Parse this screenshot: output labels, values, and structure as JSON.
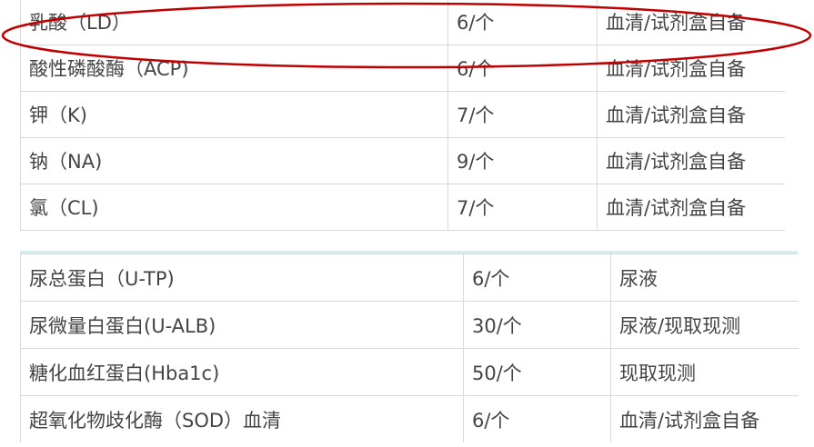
{
  "table_top": {
    "rows": [
      {
        "item": "乳酸（LD）",
        "price": "6/个",
        "sample": "血清/试剂盒自备"
      },
      {
        "item": "酸性磷酸酶（ACP)",
        "price": "6/个",
        "sample": "血清/试剂盒自备"
      },
      {
        "item": "钾（K)",
        "price": "7/个",
        "sample": "血清/试剂盒自备"
      },
      {
        "item": "钠（NA)",
        "price": "9/个",
        "sample": "血清/试剂盒自备"
      },
      {
        "item": "氯（CL)",
        "price": "7/个",
        "sample": "血清/试剂盒自备"
      }
    ]
  },
  "table_bottom": {
    "rows": [
      {
        "item": "尿总蛋白（U-TP)",
        "price": "6/个",
        "sample": "尿液"
      },
      {
        "item": "尿微量白蛋白(U-ALB)",
        "price": "30/个",
        "sample": "尿液/现取现测"
      },
      {
        "item": "糖化血红蛋白(Hba1c)",
        "price": "50/个",
        "sample": "现取现测"
      },
      {
        "item": "超氧化物歧化酶（SOD）血清",
        "price": "6/个",
        "sample": "血清/试剂盒自备"
      }
    ]
  },
  "colors": {
    "text": "#444444",
    "grid": "#d9d9d9",
    "divider": "#d8ecec",
    "highlight_ellipse": "#c00000"
  }
}
